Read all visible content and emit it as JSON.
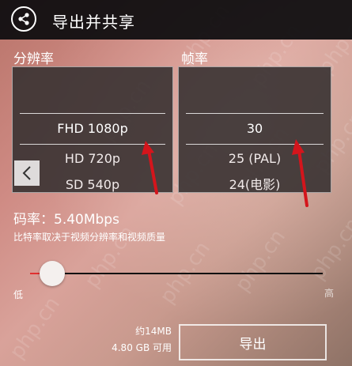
{
  "header": {
    "title": "导出并共享",
    "share_icon": "share-icon"
  },
  "resolution": {
    "label": "分辨率",
    "options": [
      "FHD 1080p",
      "HD 720p",
      "SD 540p"
    ],
    "selected": "FHD 1080p"
  },
  "framerate": {
    "label": "帧率",
    "options": [
      "30",
      "25 (PAL)",
      "24(电影)"
    ],
    "selected": "30"
  },
  "bitrate": {
    "label": "码率：5.40Mbps",
    "description": "比特率取决于视频分辨率和视频质量",
    "slider_value": 0.08,
    "low_label": "低",
    "high_label": "高"
  },
  "footer": {
    "size_estimate": "约14MB",
    "storage": "4.80 GB 可用",
    "export_label": "导出"
  },
  "watermark_text": "php.cn",
  "colors": {
    "header_bg": "#0c0c0e",
    "accent_red": "#e03030",
    "annotation_arrow": "#d4151c"
  }
}
